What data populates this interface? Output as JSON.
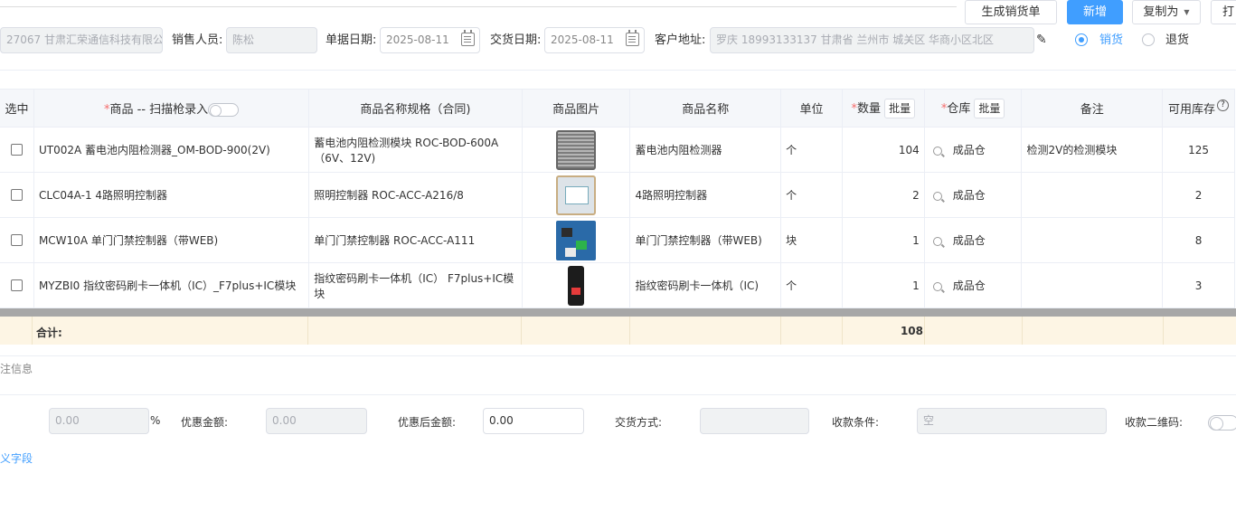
{
  "toolbar": {
    "generate_order": "生成销货单",
    "add_new": "新增",
    "copy_as": "复制为",
    "print": "打"
  },
  "form": {
    "customer_value": "27067 甘肃汇荣通信科技有限公司",
    "salesperson_label": "销售人员:",
    "salesperson_value": "陈松",
    "doc_date_label": "单据日期:",
    "doc_date_value": "2025-08-11",
    "delivery_date_label": "交货日期:",
    "delivery_date_value": "2025-08-11",
    "address_label": "客户地址:",
    "address_value": "罗庆 18993133137 甘肃省 兰州市 城关区 华商小区北区",
    "radio_sale": "销货",
    "radio_return": "退货"
  },
  "table": {
    "headers": {
      "select": "选中",
      "product": "商品 -- 扫描枪录入",
      "spec": "商品名称规格（合同)",
      "image": "商品图片",
      "name": "商品名称",
      "unit": "单位",
      "qty": "数量",
      "warehouse": "仓库",
      "remark": "备注",
      "stock": "可用库存"
    },
    "batch_label": "批量",
    "rows": [
      {
        "product": "UT002A 蓄电池内阻检测器_OM-BOD-900(2V)",
        "spec": "蓄电池内阻检测模块 ROC-BOD-600A（6V、12V)",
        "name": "蓄电池内阻检测器",
        "unit": "个",
        "qty": "104",
        "warehouse": "成品仓",
        "remark": "检测2V的检测模块",
        "stock": "125"
      },
      {
        "product": "CLC04A-1 4路照明控制器",
        "spec": "照明控制器 ROC-ACC-A216/8",
        "name": "4路照明控制器",
        "unit": "个",
        "qty": "2",
        "warehouse": "成品仓",
        "remark": "",
        "stock": "2"
      },
      {
        "product": "MCW10A 单门门禁控制器（带WEB)",
        "spec": "单门门禁控制器 ROC-ACC-A111",
        "name": "单门门禁控制器（带WEB)",
        "unit": "块",
        "qty": "1",
        "warehouse": "成品仓",
        "remark": "",
        "stock": "8"
      },
      {
        "product": "MYZBI0 指纹密码刷卡一体机（IC）_F7plus+IC模块",
        "spec": "指纹密码刷卡一体机（IC） F7plus+IC模块",
        "name": "指纹密码刷卡一体机（IC)",
        "unit": "个",
        "qty": "1",
        "warehouse": "成品仓",
        "remark": "",
        "stock": "3"
      }
    ],
    "total_label": "合计:",
    "total_qty": "108"
  },
  "bottom": {
    "section_title": "注信息",
    "discount_rate_value": "0.00",
    "percent": "%",
    "discount_amount_label": "优惠金额:",
    "discount_amount_value": "0.00",
    "after_discount_label": "优惠后金额:",
    "after_discount_value": "0.00",
    "delivery_method_label": "交货方式:",
    "payment_terms_label": "收款条件:",
    "payment_terms_value": "空",
    "qr_label": "收款二维码:",
    "custom_fields_link": "义字段"
  }
}
